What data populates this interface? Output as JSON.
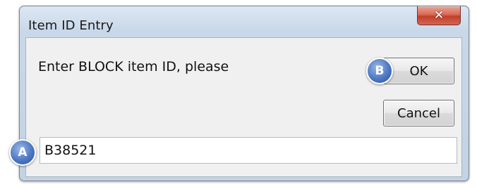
{
  "window": {
    "title": "Item ID Entry",
    "close_symbol": "✕"
  },
  "dialog": {
    "prompt": "Enter BLOCK item ID, please",
    "ok_label": "OK",
    "cancel_label": "Cancel",
    "input_value": "B38521"
  },
  "callouts": {
    "a": "A",
    "b": "B"
  },
  "colors": {
    "close_button": "#d16652",
    "callout": "#4d78c4",
    "frame": "#c3d3e4",
    "client_bg": "#f0f0f0"
  },
  "icons": {
    "close": "close-icon"
  }
}
